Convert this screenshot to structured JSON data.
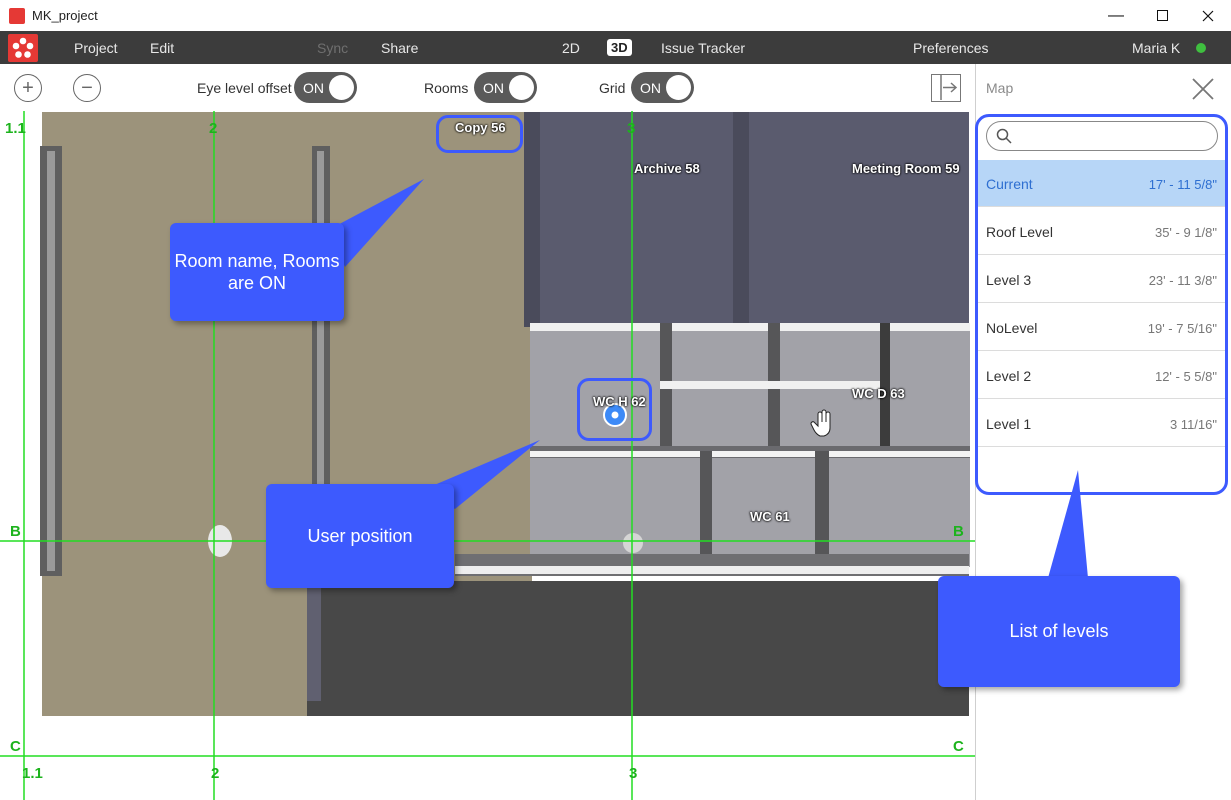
{
  "window": {
    "title": "MK_project"
  },
  "menu": {
    "project": "Project",
    "edit": "Edit",
    "sync": "Sync",
    "share": "Share",
    "mode_2d": "2D",
    "mode_3d": "3D",
    "issue_tracker": "Issue Tracker",
    "preferences": "Preferences",
    "user": "Maria K"
  },
  "toolbar": {
    "eye_level_label": "Eye level offset",
    "eye_level_state": "ON",
    "rooms_label": "Rooms",
    "rooms_state": "ON",
    "grid_label": "Grid",
    "grid_state": "ON"
  },
  "map_panel": {
    "title": "Map",
    "search_placeholder": "",
    "levels": [
      {
        "name": "Current",
        "elevation": "17' - 11 5/8\"",
        "selected": true
      },
      {
        "name": "Roof Level",
        "elevation": "35' - 9 1/8\""
      },
      {
        "name": "Level 3",
        "elevation": "23' - 11 3/8\""
      },
      {
        "name": "NoLevel",
        "elevation": "19' - 7 5/16\""
      },
      {
        "name": "Level 2",
        "elevation": "12' - 5 5/8\""
      },
      {
        "name": "Level 1",
        "elevation": "3 11/16\""
      }
    ]
  },
  "viewport": {
    "grid_labels": {
      "g11": "1.1",
      "g2": "2",
      "g3": "3",
      "gB": "B",
      "gC": "C"
    },
    "rooms": {
      "copy": "Copy 56",
      "archive": "Archive 58",
      "meeting": "Meeting Room 59",
      "wch": "WC H 62",
      "wcd": "WC D 63",
      "wc61": "WC 61"
    }
  },
  "callouts": {
    "room_name": "Room name, Rooms are ON",
    "user_position": "User position",
    "levels": "List of levels"
  },
  "colors": {
    "accent": "#3d5afe",
    "grid": "#22dd22",
    "online": "#3fbf3f",
    "menubar": "#3c3c3c",
    "selected_row": "#b7d6f7"
  }
}
